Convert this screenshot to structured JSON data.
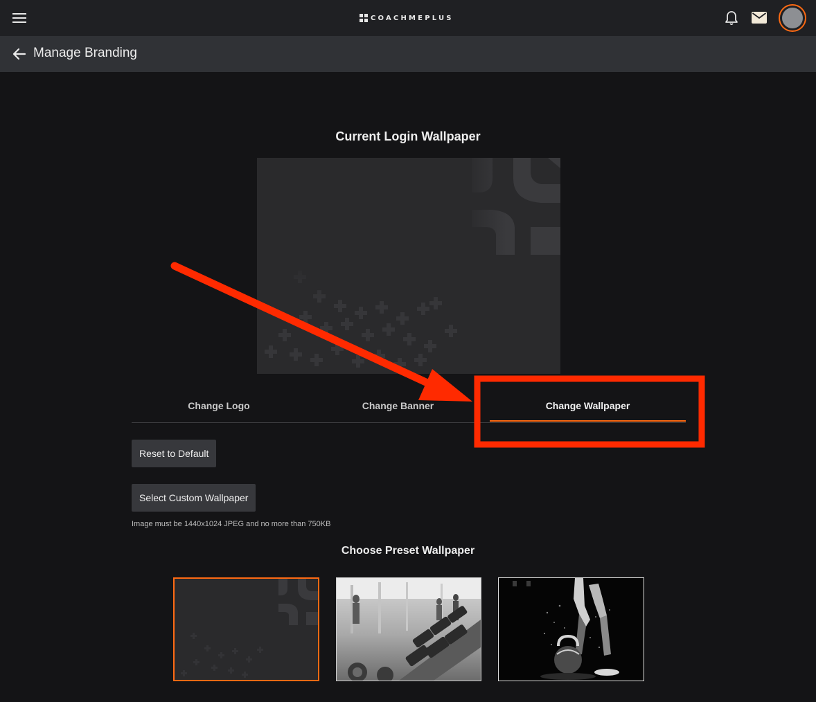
{
  "topbar": {
    "brand": "COACHMEPLUS"
  },
  "subbar": {
    "title": "Manage Branding"
  },
  "main": {
    "current_title": "Current Login Wallpaper",
    "tabs": [
      {
        "label": "Change Logo"
      },
      {
        "label": "Change Banner"
      },
      {
        "label": "Change Wallpaper"
      }
    ],
    "reset_label": "Reset to Default",
    "select_label": "Select Custom Wallpaper",
    "hint": "Image must be 1440x1024 JPEG and no more than 750KB",
    "preset_title": "Choose Preset Wallpaper"
  },
  "colors": {
    "accent": "#ff6a13",
    "annotation": "#ff2a00"
  }
}
